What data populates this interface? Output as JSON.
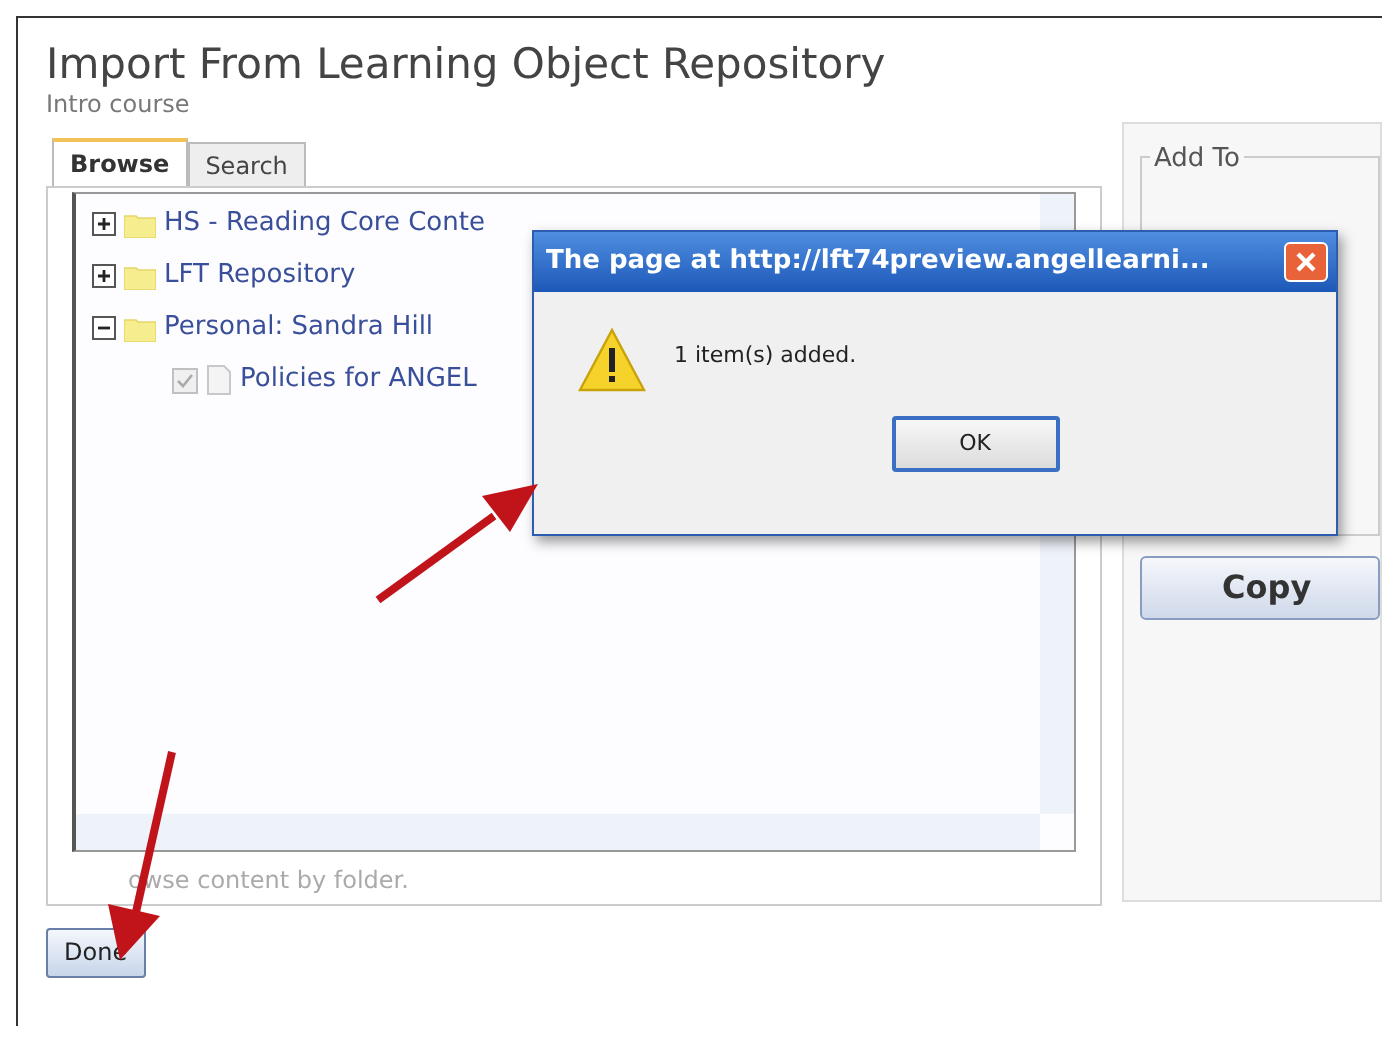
{
  "page": {
    "title": "Import From Learning Object Repository",
    "subtitle": "Intro course"
  },
  "tabs": [
    {
      "label": "Browse",
      "selected": true
    },
    {
      "label": "Search",
      "selected": false
    }
  ],
  "tree": [
    {
      "label": "HS - Reading Core Conte",
      "kind": "folder",
      "expanded": false
    },
    {
      "label": "LFT Repository",
      "kind": "folder",
      "expanded": false
    },
    {
      "label": "Personal: Sandra Hill",
      "kind": "folder",
      "expanded": true,
      "children": [
        {
          "label": "Policies for ANGEL",
          "kind": "file",
          "checked": true
        }
      ]
    }
  ],
  "hint": "owse content by folder.",
  "done_button": "Done",
  "add_to": {
    "legend": "Add To",
    "button": "Copy"
  },
  "dialog": {
    "title": "The page at http://lft74preview.angellearni...",
    "message": "1 item(s) added.",
    "button": "OK"
  }
}
